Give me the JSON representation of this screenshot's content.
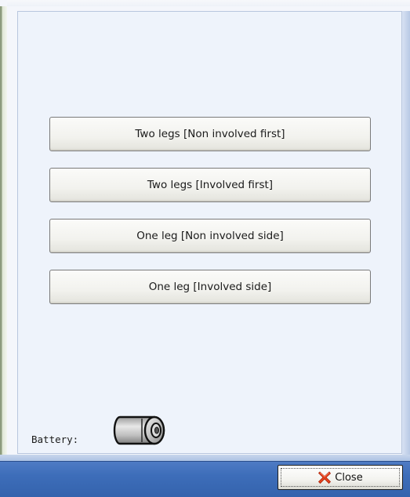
{
  "buttons": {
    "two_legs_non_involved_first": "Two legs [Non involved first]",
    "two_legs_involved_first": "Two legs [Involved first]",
    "one_leg_non_involved_side": "One leg [Non involved side]",
    "one_leg_involved_side": "One leg [Involved side]"
  },
  "battery": {
    "label": "Battery:",
    "icon": "battery-icon"
  },
  "footer": {
    "close_label": "Close",
    "close_icon": "red-x-icon"
  },
  "colors": {
    "panel_background": "#eef3fb",
    "footer_bar": "#3d6db9",
    "close_icon": "#e8411c"
  }
}
